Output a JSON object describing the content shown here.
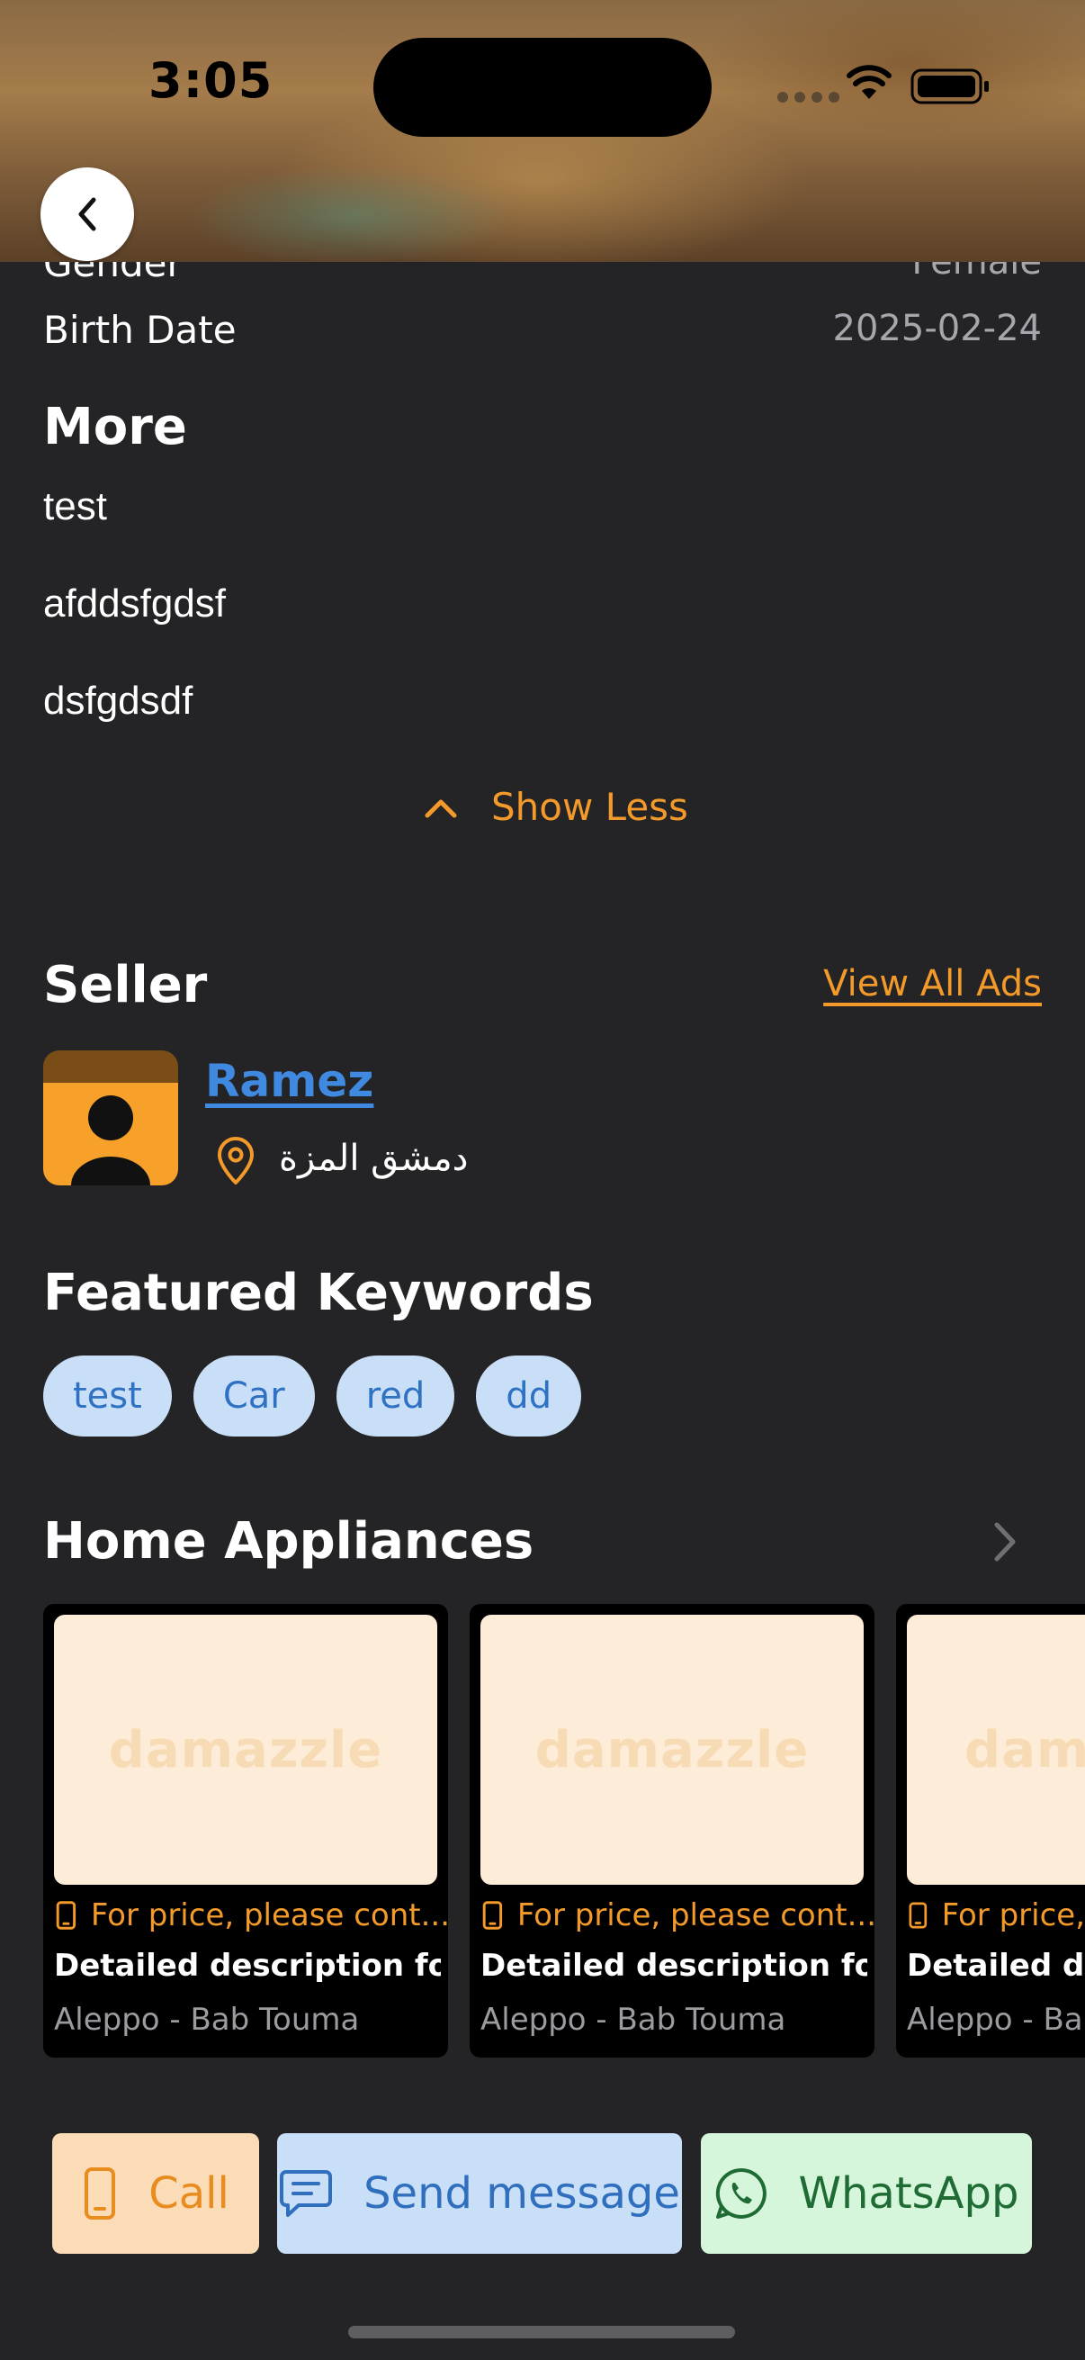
{
  "status_bar": {
    "time": "3:05"
  },
  "details": {
    "gender": {
      "label": "Gender",
      "value": "Female"
    },
    "birth_date": {
      "label": "Birth Date",
      "value": "2025-02-24"
    }
  },
  "more": {
    "title": "More",
    "items": [
      "test",
      "afddsfgdsf",
      "dsfgdsdf"
    ],
    "toggle_label": "Show Less"
  },
  "seller": {
    "title": "Seller",
    "view_all_label": "View All Ads",
    "name": "Ramez",
    "location": "دمشق المزة"
  },
  "keywords": {
    "title": "Featured Keywords",
    "items": [
      "test",
      "Car",
      "red",
      "dd"
    ]
  },
  "category": {
    "title": "Home Appliances",
    "ads": [
      {
        "watermark": "damazzle",
        "price": "For price, please cont...",
        "title": "Detailed description for t...",
        "location": "Aleppo - Bab Touma"
      },
      {
        "watermark": "damazzle",
        "price": "For price, please cont...",
        "title": "Detailed description for t...",
        "location": "Aleppo - Bab Touma"
      },
      {
        "watermark": "dam",
        "price": "For price,",
        "title": "Detailed desc",
        "location": "Aleppo - Bab"
      }
    ]
  },
  "actions": {
    "call": "Call",
    "message": "Send message",
    "whatsapp": "WhatsApp"
  },
  "colors": {
    "background": "#242427",
    "accent_orange": "#f39a2a",
    "link_blue": "#3f8ae0",
    "chip_bg": "#c9dff7"
  }
}
